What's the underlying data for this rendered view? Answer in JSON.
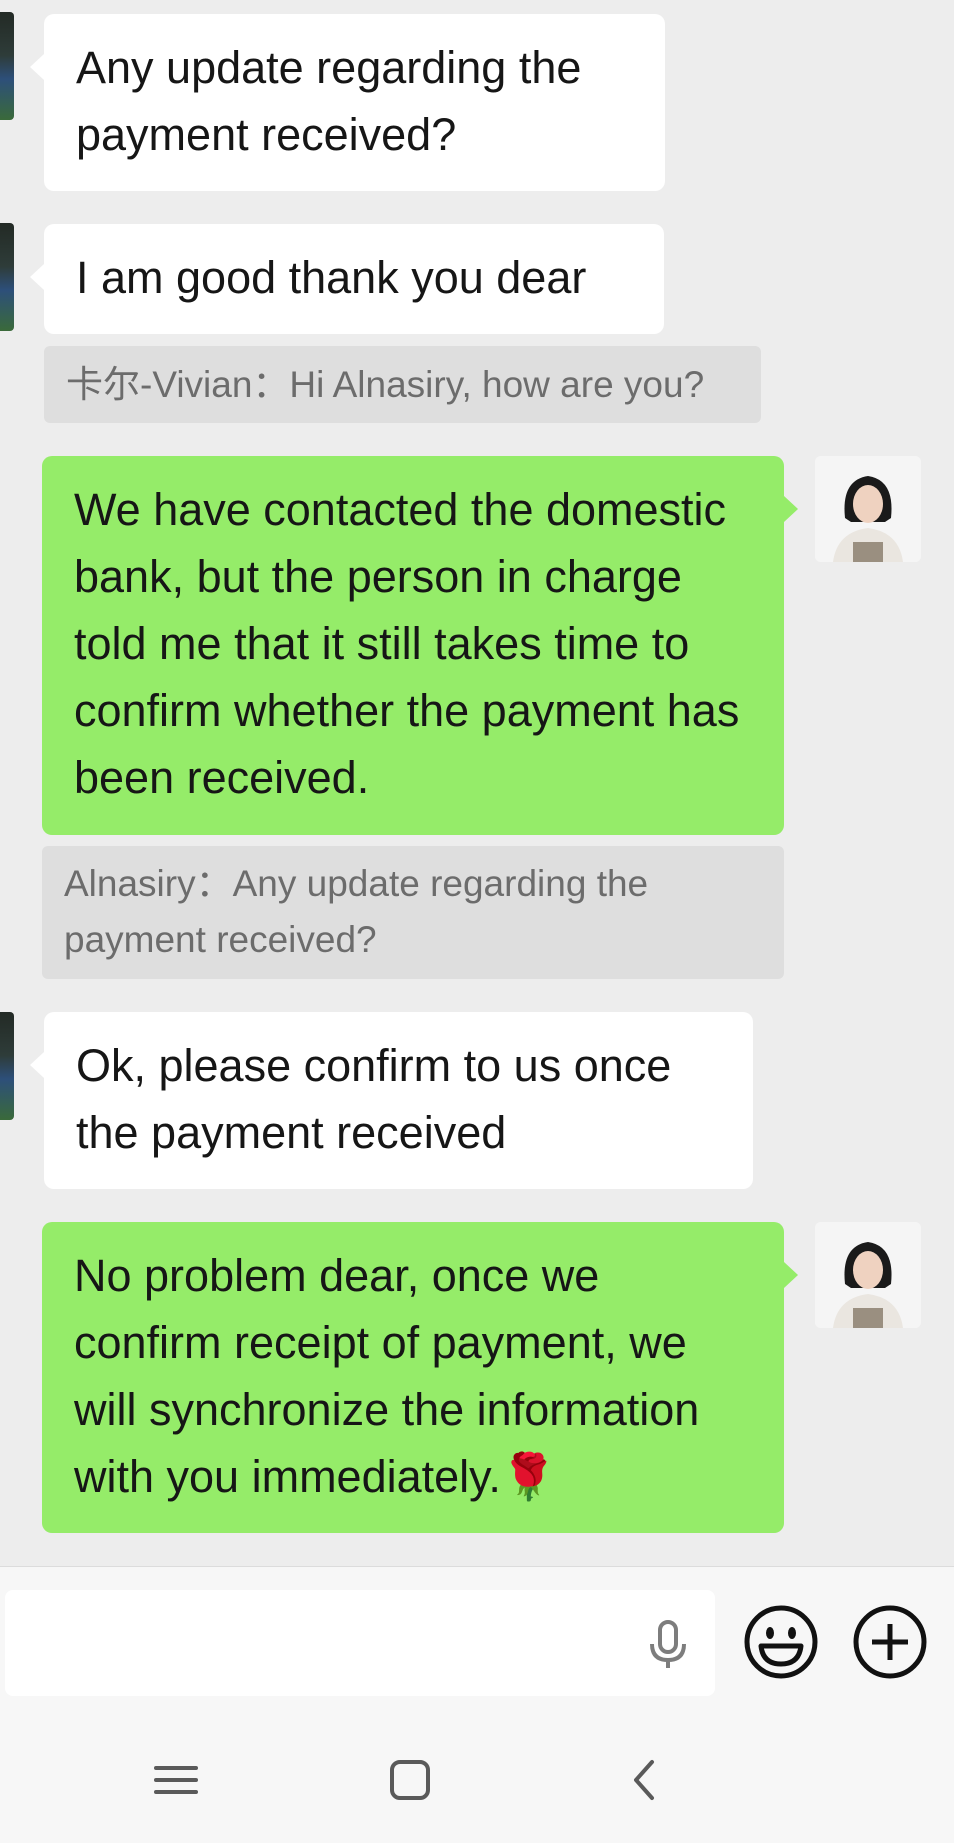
{
  "messages": [
    {
      "from": "contact",
      "text": "Any update regarding the payment received?"
    },
    {
      "from": "contact",
      "text": "I am good thank you dear"
    },
    {
      "quote": "卡尔-Vivian：Hi Alnasiry, how are you?"
    },
    {
      "from": "me",
      "text": "We have contacted the domestic bank, but the person in charge told me that it still takes time to confirm whether the payment has been received."
    },
    {
      "quote": "Alnasiry：Any update regarding the payment received?"
    },
    {
      "from": "contact",
      "text": "Ok, please confirm to us once the payment received"
    },
    {
      "from": "me",
      "text": "No problem dear, once we confirm receipt of payment, we will synchronize the information with you immediately.🌹"
    }
  ],
  "composer": {
    "placeholder": "",
    "icons": [
      "microphone-icon",
      "emoji-icon",
      "plus-icon"
    ]
  },
  "navbar": {
    "icons": [
      "menu-icon",
      "home-square-icon",
      "back-chevron-icon"
    ]
  },
  "colors": {
    "background": "#ededed",
    "outgoing_bubble": "#95ec69",
    "incoming_bubble": "#ffffff",
    "quote_bg": "#dedede",
    "quote_text": "#6c6c6c"
  }
}
